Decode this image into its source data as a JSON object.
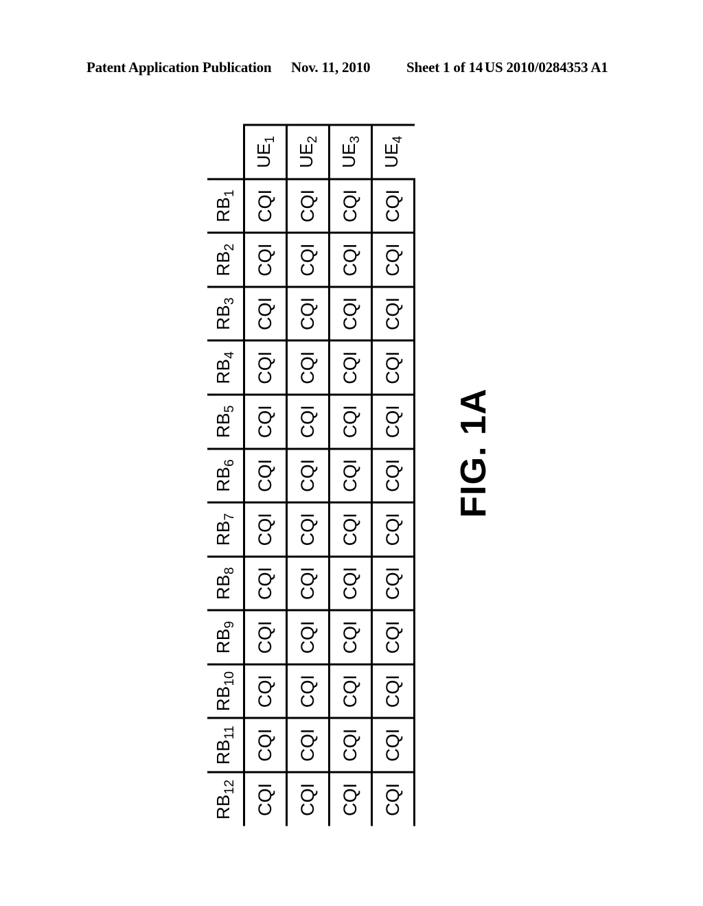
{
  "page_header": {
    "publication_label": "Patent Application Publication",
    "date": "Nov. 11, 2010",
    "sheet": "Sheet 1 of 14",
    "patent_number": "US 2010/0284353 A1"
  },
  "figure": {
    "caption": "FIG. 1A",
    "rotation_degrees": -90,
    "corner_cell": ""
  },
  "table": {
    "row_header_prefix": "RB",
    "column_header_prefix": "UE",
    "cell_value": "CQI",
    "row_headers": [
      {
        "prefix": "RB",
        "index": "12"
      },
      {
        "prefix": "RB",
        "index": "11"
      },
      {
        "prefix": "RB",
        "index": "10"
      },
      {
        "prefix": "RB",
        "index": "9"
      },
      {
        "prefix": "RB",
        "index": "8"
      },
      {
        "prefix": "RB",
        "index": "7"
      },
      {
        "prefix": "RB",
        "index": "6"
      },
      {
        "prefix": "RB",
        "index": "5"
      },
      {
        "prefix": "RB",
        "index": "4"
      },
      {
        "prefix": "RB",
        "index": "3"
      },
      {
        "prefix": "RB",
        "index": "2"
      },
      {
        "prefix": "RB",
        "index": "1"
      }
    ],
    "column_headers": [
      {
        "prefix": "UE",
        "index": "1"
      },
      {
        "prefix": "UE",
        "index": "2"
      },
      {
        "prefix": "UE",
        "index": "3"
      },
      {
        "prefix": "UE",
        "index": "4"
      }
    ],
    "rows": [
      {
        "header_index": "12",
        "cells": [
          "CQI",
          "CQI",
          "CQI",
          "CQI"
        ]
      },
      {
        "header_index": "11",
        "cells": [
          "CQI",
          "CQI",
          "CQI",
          "CQI"
        ]
      },
      {
        "header_index": "10",
        "cells": [
          "CQI",
          "CQI",
          "CQI",
          "CQI"
        ]
      },
      {
        "header_index": "9",
        "cells": [
          "CQI",
          "CQI",
          "CQI",
          "CQI"
        ]
      },
      {
        "header_index": "8",
        "cells": [
          "CQI",
          "CQI",
          "CQI",
          "CQI"
        ]
      },
      {
        "header_index": "7",
        "cells": [
          "CQI",
          "CQI",
          "CQI",
          "CQI"
        ]
      },
      {
        "header_index": "6",
        "cells": [
          "CQI",
          "CQI",
          "CQI",
          "CQI"
        ]
      },
      {
        "header_index": "5",
        "cells": [
          "CQI",
          "CQI",
          "CQI",
          "CQI"
        ]
      },
      {
        "header_index": "4",
        "cells": [
          "CQI",
          "CQI",
          "CQI",
          "CQI"
        ]
      },
      {
        "header_index": "3",
        "cells": [
          "CQI",
          "CQI",
          "CQI",
          "CQI"
        ]
      },
      {
        "header_index": "2",
        "cells": [
          "CQI",
          "CQI",
          "CQI",
          "CQI"
        ]
      },
      {
        "header_index": "1",
        "cells": [
          "CQI",
          "CQI",
          "CQI",
          "CQI"
        ]
      }
    ]
  },
  "colors": {
    "ink": "#000000",
    "paper": "#ffffff"
  }
}
